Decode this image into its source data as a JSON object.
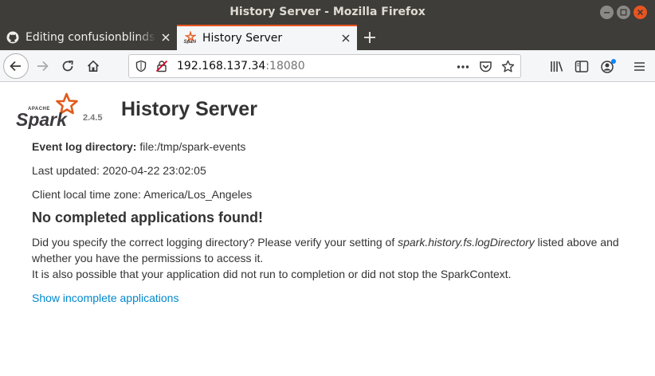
{
  "window": {
    "title": "History Server - Mozilla Firefox"
  },
  "tabs": [
    {
      "label": "Editing confusionblinds.c",
      "icon": "github-icon",
      "active": false
    },
    {
      "label": "History Server",
      "icon": "spark-icon",
      "active": true
    }
  ],
  "navbar": {
    "url_host": "192.168.137.34",
    "url_port": ":18080"
  },
  "colors": {
    "titlebar": "#3e3d39",
    "active_tab_accent": "#e95420",
    "link": "#0088cc",
    "spark_orange": "#e25a1c"
  },
  "page": {
    "logo": {
      "small_text": "APACHE",
      "word": "Spark"
    },
    "version": "2.4.5",
    "heading": "History Server",
    "event_log_label": "Event log directory:",
    "event_log_value": "file:/tmp/spark-events",
    "last_updated": "Last updated: 2020-04-22 23:02:05",
    "timezone": "Client local time zone: America/Los_Angeles",
    "no_apps_heading": "No completed applications found!",
    "message_part1": "Did you specify the correct logging directory? Please verify your setting of ",
    "message_setting": "spark.history.fs.logDirectory",
    "message_part2": " listed above and",
    "message_line2": "whether you have the permissions to access it.",
    "message_line3": "It is also possible that your application did not run to completion or did not stop the SparkContext.",
    "incomplete_link": "Show incomplete applications"
  }
}
